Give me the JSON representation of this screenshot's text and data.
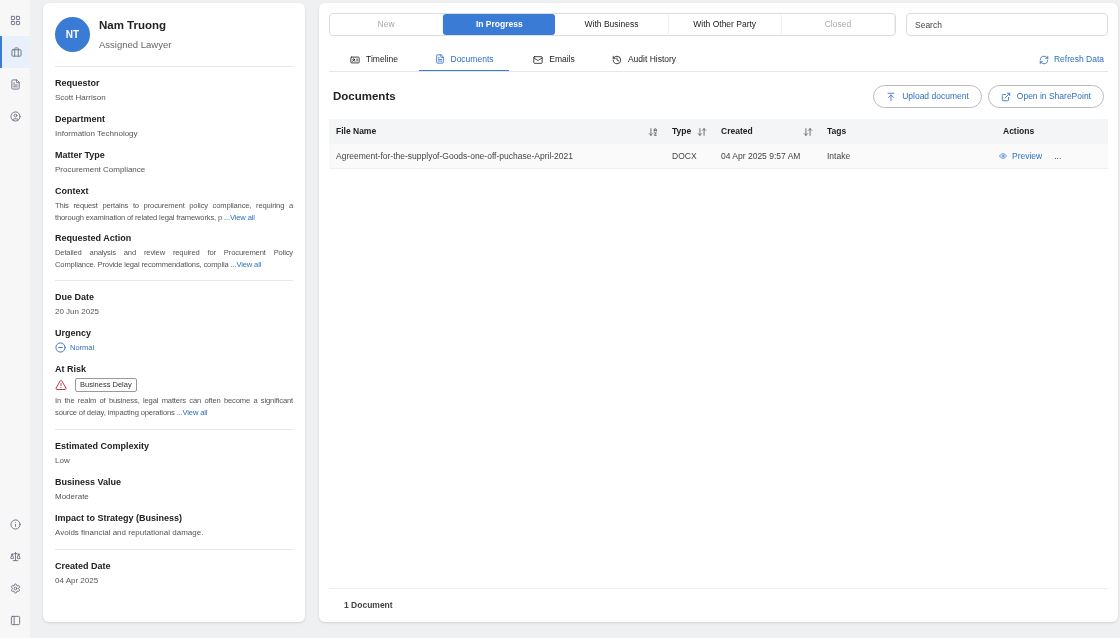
{
  "sidebar": {
    "top_items": [
      {
        "kind": "grid",
        "selected": false
      },
      {
        "kind": "briefcase",
        "selected": true
      },
      {
        "kind": "document",
        "selected": false
      },
      {
        "kind": "user",
        "selected": false
      }
    ],
    "bottom_items": [
      {
        "kind": "info",
        "selected": false
      },
      {
        "kind": "scale",
        "selected": false
      },
      {
        "kind": "settings",
        "selected": false
      },
      {
        "kind": "panel",
        "selected": false
      }
    ]
  },
  "profile": {
    "initials": "NT",
    "name": "Nam Truong",
    "role": "Assigned Lawyer"
  },
  "groups": [
    [
      {
        "kind": "text",
        "label": "Requestor",
        "value": "Scott Harrison"
      },
      {
        "kind": "text",
        "label": "Department",
        "value": "Information Technology"
      },
      {
        "kind": "text",
        "label": "Matter Type",
        "value": "Procurement Compliance"
      },
      {
        "kind": "description",
        "label": "Context",
        "value": "This request pertains to procurement policy compliance, requiring a thorough examination of related legal frameworks, p",
        "link": "...View all"
      },
      {
        "kind": "description",
        "label": "Requested Action",
        "value": "Detailed analysis and review required for Procurement Policy Compliance. Provide legal recommendations, complia",
        "link": "...View all"
      }
    ],
    [
      {
        "kind": "text",
        "label": "Due Date",
        "value": "20 Jun 2025"
      },
      {
        "kind": "urgency",
        "label": "Urgency",
        "value": "Normal"
      },
      {
        "kind": "risk",
        "label": "At Risk",
        "tag": "Business Delay",
        "value": "In the realm of business, legal matters can often become a significant source of delay, impacting operations",
        "link": "...View all"
      }
    ],
    [
      {
        "kind": "text",
        "label": "Estimated Complexity",
        "value": "Low"
      },
      {
        "kind": "text",
        "label": "Business Value",
        "value": "Moderate"
      },
      {
        "kind": "text",
        "label": "Impact to Strategy (Business)",
        "value": "Avoids financial and reputational damage."
      }
    ],
    [
      {
        "kind": "text",
        "label": "Created Date",
        "value": "04 Apr 2025"
      }
    ]
  ],
  "status_tabs": [
    {
      "label": "New",
      "selected": false,
      "disabled": true
    },
    {
      "label": "In Progress",
      "selected": true,
      "disabled": false
    },
    {
      "label": "With Business",
      "selected": false,
      "disabled": false
    },
    {
      "label": "With Other Party",
      "selected": false,
      "disabled": false
    },
    {
      "label": "Closed",
      "selected": false,
      "disabled": true
    }
  ],
  "search": {
    "placeholder": "Search"
  },
  "tabs": [
    {
      "kind": "timeline",
      "label": "Timeline",
      "selected": false
    },
    {
      "kind": "documents",
      "label": "Documents",
      "selected": true
    },
    {
      "kind": "emails",
      "label": "Emails",
      "selected": false
    },
    {
      "kind": "history",
      "label": "Audit History",
      "selected": false
    }
  ],
  "refresh": "Refresh Data",
  "section_title": "Documents",
  "buttons": [
    {
      "kind": "upload",
      "label": "Upload document"
    },
    {
      "kind": "external",
      "label": "Open in SharePoint"
    }
  ],
  "table": {
    "columns": [
      {
        "label": "File Name",
        "kind": "alpha"
      },
      {
        "label": "Type",
        "kind": "sortable"
      },
      {
        "label": "Created",
        "kind": "sortable"
      },
      {
        "label": "Tags",
        "kind": "plain"
      },
      {
        "label": "Actions",
        "kind": "plain"
      }
    ],
    "rows": [
      {
        "file_name": "Agreement-for-the-supplyof-Goods-one-off-puchase-April-2021",
        "type": "DOCX",
        "created": "04 Apr 2025 9:57 AM",
        "tags": "Intake",
        "action": "Preview",
        "more": "..."
      }
    ]
  },
  "footer": "1 Document"
}
